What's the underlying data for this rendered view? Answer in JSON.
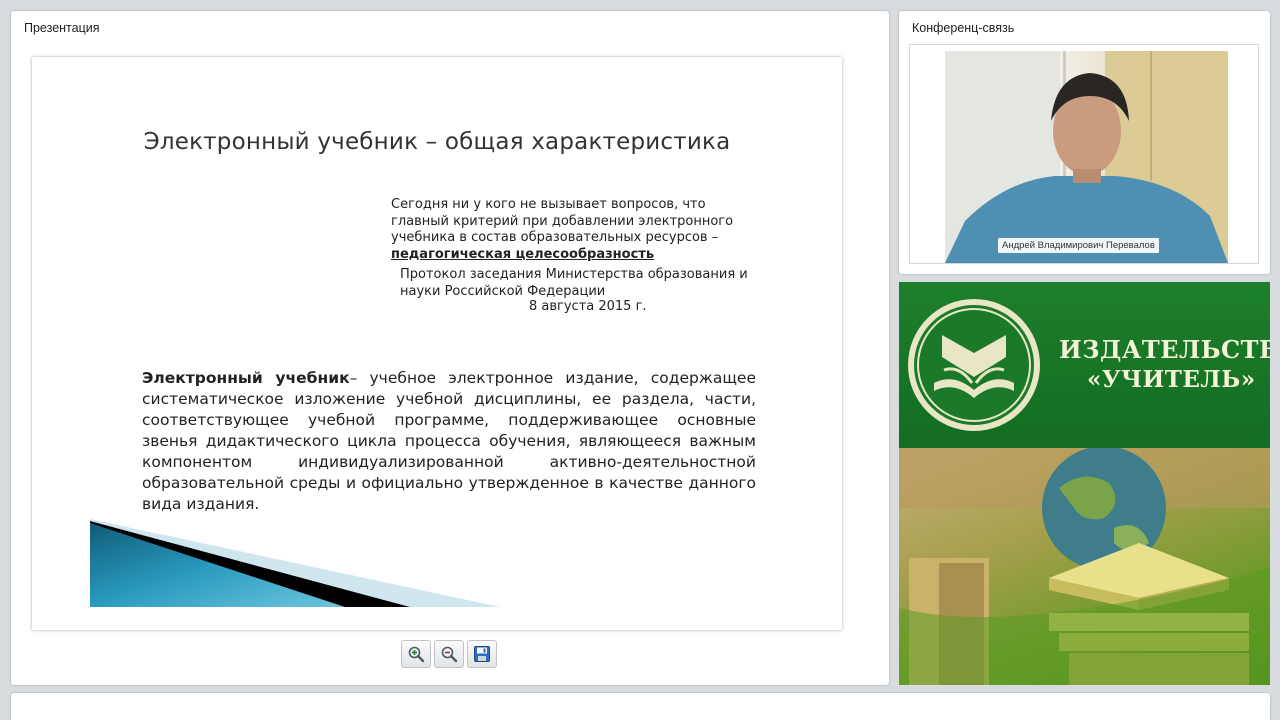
{
  "presentation_panel": {
    "title": "Презентация"
  },
  "slide": {
    "title": "Электронный учебник – общая характеристика",
    "quote_line1": "Сегодня ни у кого не вызывает вопросов,  что",
    "quote_line2": "главный критерий при добавлении электронного",
    "quote_line3": "учебника в состав образовательных ресурсов –",
    "quote_emphasis": "педагогическая  целесообразность",
    "source_line1": "Протокол заседания Министерства  образования  и",
    "source_line2": "науки Российской Федерации",
    "source_date": "8 августа 2015 г.",
    "definition_term": "Электронный учебник",
    "definition_text": "– учебное электронное издание, содержащее систематическое изложение учебной дисциплины, ее раздела, части, соответствующее учебной программе, поддерживающее основные звенья дидактического цикла процесса обучения, являющееся важным компонентом индивидуализированной активно-деятельностной образовательной среды и официально утвержденное в качестве данного вида издания."
  },
  "toolbar": {
    "zoom_in_icon": "zoom-in-icon",
    "zoom_out_icon": "zoom-out-icon",
    "save_icon": "floppy-disk-icon"
  },
  "conference_panel": {
    "title": "Конференц-связь",
    "speaker_name": "Андрей Владимирович Перевалов"
  },
  "advert": {
    "brand_line1": "ИЗДАТЕЛЬСТВО",
    "brand_line2": "«УЧИТЕЛЬ»"
  },
  "colors": {
    "background": "#d9dcdf",
    "brand_green": "#1a7a2a",
    "brand_text": "#f4f3d6"
  }
}
